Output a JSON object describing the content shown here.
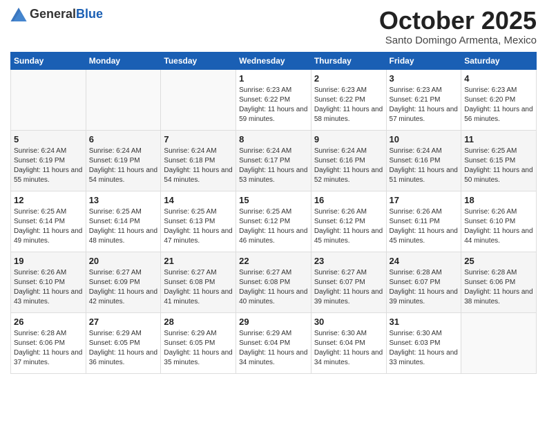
{
  "header": {
    "logo_general": "General",
    "logo_blue": "Blue",
    "month_title": "October 2025",
    "subtitle": "Santo Domingo Armenta, Mexico"
  },
  "days_of_week": [
    "Sunday",
    "Monday",
    "Tuesday",
    "Wednesday",
    "Thursday",
    "Friday",
    "Saturday"
  ],
  "weeks": [
    [
      {
        "day": "",
        "sunrise": "",
        "sunset": "",
        "daylight": ""
      },
      {
        "day": "",
        "sunrise": "",
        "sunset": "",
        "daylight": ""
      },
      {
        "day": "",
        "sunrise": "",
        "sunset": "",
        "daylight": ""
      },
      {
        "day": "1",
        "sunrise": "Sunrise: 6:23 AM",
        "sunset": "Sunset: 6:22 PM",
        "daylight": "Daylight: 11 hours and 59 minutes."
      },
      {
        "day": "2",
        "sunrise": "Sunrise: 6:23 AM",
        "sunset": "Sunset: 6:22 PM",
        "daylight": "Daylight: 11 hours and 58 minutes."
      },
      {
        "day": "3",
        "sunrise": "Sunrise: 6:23 AM",
        "sunset": "Sunset: 6:21 PM",
        "daylight": "Daylight: 11 hours and 57 minutes."
      },
      {
        "day": "4",
        "sunrise": "Sunrise: 6:23 AM",
        "sunset": "Sunset: 6:20 PM",
        "daylight": "Daylight: 11 hours and 56 minutes."
      }
    ],
    [
      {
        "day": "5",
        "sunrise": "Sunrise: 6:24 AM",
        "sunset": "Sunset: 6:19 PM",
        "daylight": "Daylight: 11 hours and 55 minutes."
      },
      {
        "day": "6",
        "sunrise": "Sunrise: 6:24 AM",
        "sunset": "Sunset: 6:19 PM",
        "daylight": "Daylight: 11 hours and 54 minutes."
      },
      {
        "day": "7",
        "sunrise": "Sunrise: 6:24 AM",
        "sunset": "Sunset: 6:18 PM",
        "daylight": "Daylight: 11 hours and 54 minutes."
      },
      {
        "day": "8",
        "sunrise": "Sunrise: 6:24 AM",
        "sunset": "Sunset: 6:17 PM",
        "daylight": "Daylight: 11 hours and 53 minutes."
      },
      {
        "day": "9",
        "sunrise": "Sunrise: 6:24 AM",
        "sunset": "Sunset: 6:16 PM",
        "daylight": "Daylight: 11 hours and 52 minutes."
      },
      {
        "day": "10",
        "sunrise": "Sunrise: 6:24 AM",
        "sunset": "Sunset: 6:16 PM",
        "daylight": "Daylight: 11 hours and 51 minutes."
      },
      {
        "day": "11",
        "sunrise": "Sunrise: 6:25 AM",
        "sunset": "Sunset: 6:15 PM",
        "daylight": "Daylight: 11 hours and 50 minutes."
      }
    ],
    [
      {
        "day": "12",
        "sunrise": "Sunrise: 6:25 AM",
        "sunset": "Sunset: 6:14 PM",
        "daylight": "Daylight: 11 hours and 49 minutes."
      },
      {
        "day": "13",
        "sunrise": "Sunrise: 6:25 AM",
        "sunset": "Sunset: 6:14 PM",
        "daylight": "Daylight: 11 hours and 48 minutes."
      },
      {
        "day": "14",
        "sunrise": "Sunrise: 6:25 AM",
        "sunset": "Sunset: 6:13 PM",
        "daylight": "Daylight: 11 hours and 47 minutes."
      },
      {
        "day": "15",
        "sunrise": "Sunrise: 6:25 AM",
        "sunset": "Sunset: 6:12 PM",
        "daylight": "Daylight: 11 hours and 46 minutes."
      },
      {
        "day": "16",
        "sunrise": "Sunrise: 6:26 AM",
        "sunset": "Sunset: 6:12 PM",
        "daylight": "Daylight: 11 hours and 45 minutes."
      },
      {
        "day": "17",
        "sunrise": "Sunrise: 6:26 AM",
        "sunset": "Sunset: 6:11 PM",
        "daylight": "Daylight: 11 hours and 45 minutes."
      },
      {
        "day": "18",
        "sunrise": "Sunrise: 6:26 AM",
        "sunset": "Sunset: 6:10 PM",
        "daylight": "Daylight: 11 hours and 44 minutes."
      }
    ],
    [
      {
        "day": "19",
        "sunrise": "Sunrise: 6:26 AM",
        "sunset": "Sunset: 6:10 PM",
        "daylight": "Daylight: 11 hours and 43 minutes."
      },
      {
        "day": "20",
        "sunrise": "Sunrise: 6:27 AM",
        "sunset": "Sunset: 6:09 PM",
        "daylight": "Daylight: 11 hours and 42 minutes."
      },
      {
        "day": "21",
        "sunrise": "Sunrise: 6:27 AM",
        "sunset": "Sunset: 6:08 PM",
        "daylight": "Daylight: 11 hours and 41 minutes."
      },
      {
        "day": "22",
        "sunrise": "Sunrise: 6:27 AM",
        "sunset": "Sunset: 6:08 PM",
        "daylight": "Daylight: 11 hours and 40 minutes."
      },
      {
        "day": "23",
        "sunrise": "Sunrise: 6:27 AM",
        "sunset": "Sunset: 6:07 PM",
        "daylight": "Daylight: 11 hours and 39 minutes."
      },
      {
        "day": "24",
        "sunrise": "Sunrise: 6:28 AM",
        "sunset": "Sunset: 6:07 PM",
        "daylight": "Daylight: 11 hours and 39 minutes."
      },
      {
        "day": "25",
        "sunrise": "Sunrise: 6:28 AM",
        "sunset": "Sunset: 6:06 PM",
        "daylight": "Daylight: 11 hours and 38 minutes."
      }
    ],
    [
      {
        "day": "26",
        "sunrise": "Sunrise: 6:28 AM",
        "sunset": "Sunset: 6:06 PM",
        "daylight": "Daylight: 11 hours and 37 minutes."
      },
      {
        "day": "27",
        "sunrise": "Sunrise: 6:29 AM",
        "sunset": "Sunset: 6:05 PM",
        "daylight": "Daylight: 11 hours and 36 minutes."
      },
      {
        "day": "28",
        "sunrise": "Sunrise: 6:29 AM",
        "sunset": "Sunset: 6:05 PM",
        "daylight": "Daylight: 11 hours and 35 minutes."
      },
      {
        "day": "29",
        "sunrise": "Sunrise: 6:29 AM",
        "sunset": "Sunset: 6:04 PM",
        "daylight": "Daylight: 11 hours and 34 minutes."
      },
      {
        "day": "30",
        "sunrise": "Sunrise: 6:30 AM",
        "sunset": "Sunset: 6:04 PM",
        "daylight": "Daylight: 11 hours and 34 minutes."
      },
      {
        "day": "31",
        "sunrise": "Sunrise: 6:30 AM",
        "sunset": "Sunset: 6:03 PM",
        "daylight": "Daylight: 11 hours and 33 minutes."
      },
      {
        "day": "",
        "sunrise": "",
        "sunset": "",
        "daylight": ""
      }
    ]
  ]
}
